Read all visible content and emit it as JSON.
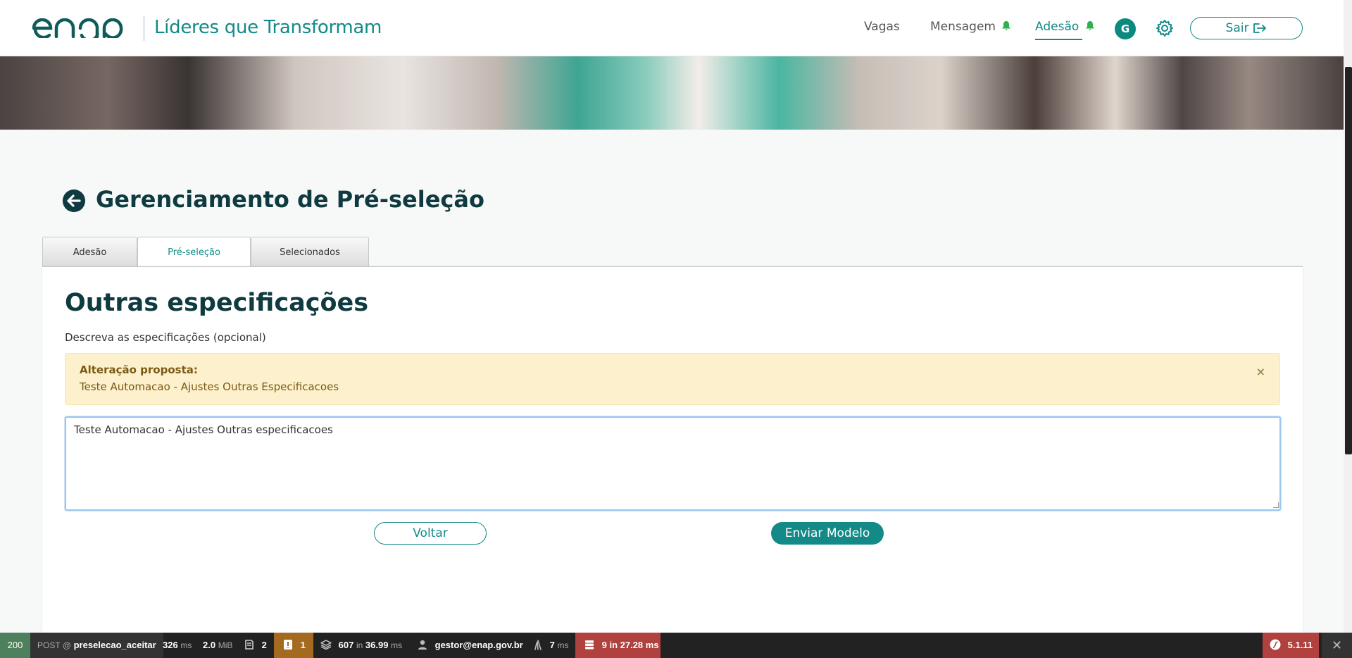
{
  "header": {
    "logo_text": "enap",
    "tagline": "Líderes que Transformam",
    "nav": [
      {
        "label": "Vagas"
      },
      {
        "label": "Mensagem"
      },
      {
        "label": "Adesão"
      }
    ],
    "avatar_initial": "G",
    "logout_label": "Sair"
  },
  "page": {
    "title": "Gerenciamento de Pré-seleção",
    "tabs": [
      {
        "label": "Adesão"
      },
      {
        "label": "Pré-seleção",
        "active": true
      },
      {
        "label": "Selecionados"
      }
    ]
  },
  "section": {
    "title": "Outras especificações",
    "description": "Descreva as especificações (opcional)",
    "alert": {
      "title": "Alteração proposta:",
      "text": "Teste Automacao - Ajustes Outras Especificacoes",
      "close": "×"
    },
    "textarea_value": "Teste Automacao - Ajustes Outras especificacoes",
    "back_button": "Voltar",
    "submit_button": "Enviar Modelo"
  },
  "debug_toolbar": {
    "status": "200",
    "method": "POST @",
    "route": "preselecao_aceitar",
    "time_value": "326",
    "time_unit": "ms",
    "memory_value": "2.0",
    "memory_unit": "MiB",
    "forms_count": "2",
    "warnings_count": "1",
    "twig_value": "607",
    "twig_in": "in",
    "twig_time": "36.99",
    "twig_unit": "ms",
    "user": "gestor@enap.gov.br",
    "ajax_time": "7",
    "ajax_unit": "ms",
    "db_summary": "9 in 27.28 ms",
    "symfony_version": "5.1.11",
    "close": "✕"
  },
  "colors": {
    "primary": "#138a87",
    "title": "#0f3b40",
    "alert_bg": "#fdf0cc",
    "bell": "#2db14f"
  }
}
